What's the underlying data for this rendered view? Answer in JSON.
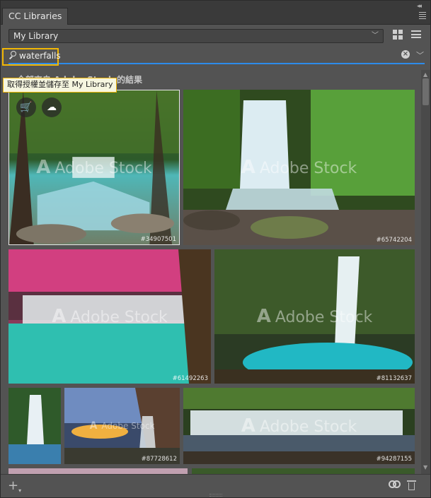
{
  "window": {
    "tab_title": "CC Libraries",
    "collapse_glyph": "◂◂"
  },
  "library": {
    "selected": "My Library"
  },
  "search": {
    "value": "waterfalls",
    "clear_glyph": "×"
  },
  "results": {
    "section_title": "全部來自 Adobe Stock 的結果",
    "tooltip": "取得授權並儲存至 My Library",
    "watermark": "Adobe Stock",
    "watermark_logo": "A",
    "cart_glyph": "🛒",
    "cloud_glyph": "☁",
    "images": [
      {
        "id": "#34907501"
      },
      {
        "id": "#65742204"
      },
      {
        "id": "#61492263"
      },
      {
        "id": "#81132637"
      },
      {
        "id": ""
      },
      {
        "id": "#87728612"
      },
      {
        "id": "#94287155"
      }
    ]
  },
  "footer": {
    "add_glyph": "+"
  },
  "colors": {
    "panel_bg": "#535353",
    "accent_blue": "#2d8ceb",
    "highlight_yellow": "#f2b705"
  },
  "icons": [
    "search-icon",
    "clear-icon",
    "chevron-down-icon",
    "grid-view-icon",
    "list-view-icon",
    "cart-icon",
    "cloud-icon",
    "plus-icon",
    "creative-cloud-icon",
    "trash-icon"
  ]
}
